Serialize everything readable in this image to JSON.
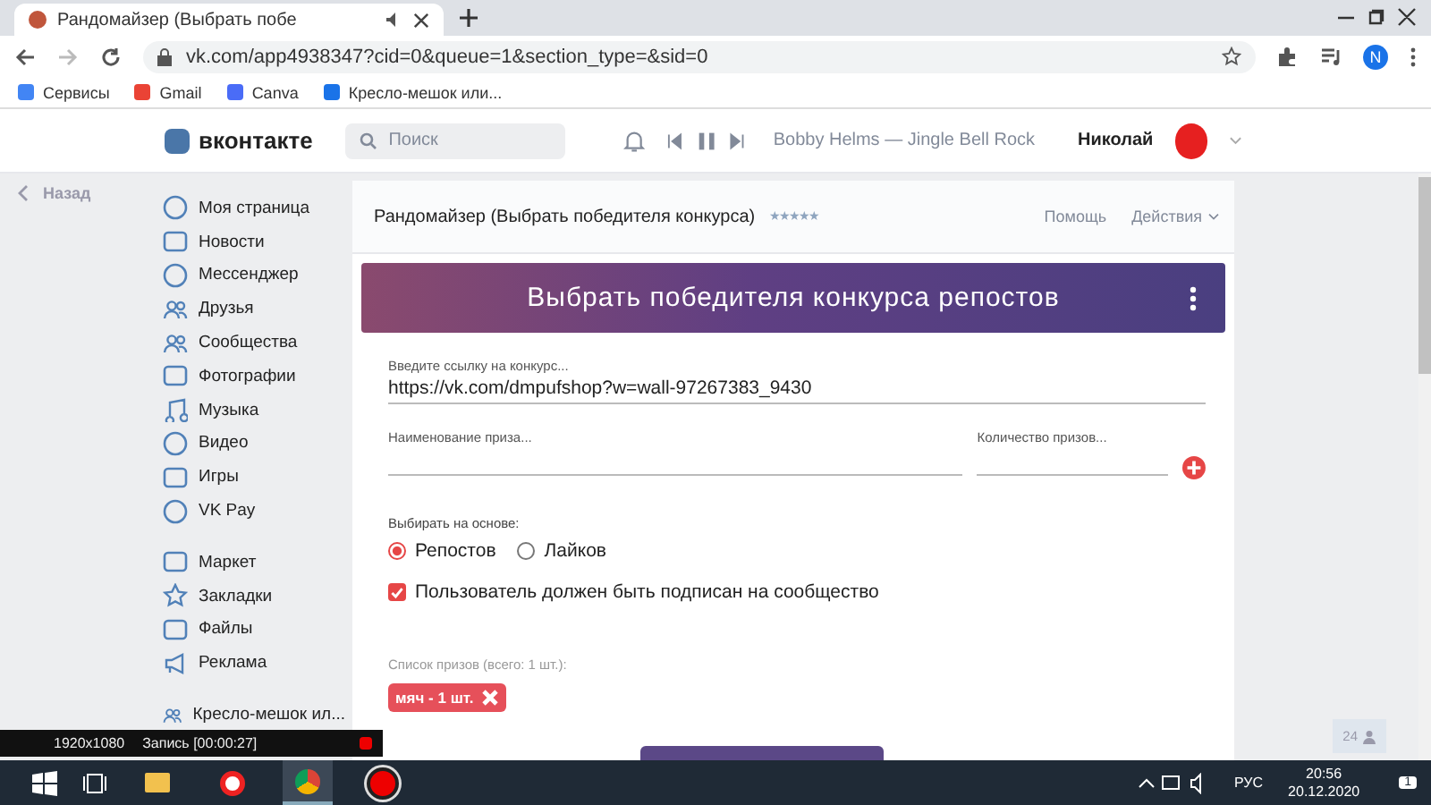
{
  "browser": {
    "tab_title": "Рандомайзер (Выбрать побе",
    "url": "vk.com/app4938347?cid=0&queue=1&section_type=&sid=0",
    "profile_initial": "N",
    "bookmarks": [
      {
        "label": "Сервисы",
        "kind": "apps"
      },
      {
        "label": "Gmail",
        "kind": "gmail"
      },
      {
        "label": "Canva",
        "kind": "canva"
      },
      {
        "label": "Кресло-мешок или...",
        "kind": "play"
      }
    ]
  },
  "header": {
    "logo": "вконтакте",
    "search_placeholder": "Поиск",
    "track": "Bobby Helms — Jingle Bell Rock",
    "user": "Николай"
  },
  "back": "Назад",
  "menu": [
    [
      {
        "label": "Моя страница",
        "kind": "user"
      },
      {
        "label": "Новости",
        "kind": "news"
      },
      {
        "label": "Мессенджер",
        "kind": "chat"
      },
      {
        "label": "Друзья",
        "kind": "friends"
      },
      {
        "label": "Сообщества",
        "kind": "groups"
      },
      {
        "label": "Фотографии",
        "kind": "photo"
      },
      {
        "label": "Музыка",
        "kind": "music"
      },
      {
        "label": "Видео",
        "kind": "video"
      },
      {
        "label": "Игры",
        "kind": "games"
      },
      {
        "label": "VK Pay",
        "kind": "pay"
      }
    ],
    [
      {
        "label": "Маркет",
        "kind": "market"
      },
      {
        "label": "Закладки",
        "kind": "star"
      },
      {
        "label": "Файлы",
        "kind": "file"
      },
      {
        "label": "Реклама",
        "kind": "ads"
      }
    ],
    [
      {
        "label": "Кресло-мешок ил...",
        "kind": "groups"
      }
    ]
  ],
  "app": {
    "title": "Рандомайзер (Выбрать победителя конкурса)",
    "stars": 5,
    "help": "Помощь",
    "actions": "Действия",
    "banner": "Выбрать победителя конкурса репостов",
    "link_label": "Введите ссылку на конкурс...",
    "link_value": "https://vk.com/dmpufshop?w=wall-97267383_9430",
    "prize_placeholder": "Наименование приза...",
    "count_placeholder": "Количество призов...",
    "basis_label": "Выбирать на основе:",
    "basis": [
      {
        "label": "Репостов",
        "selected": true
      },
      {
        "label": "Лайков",
        "selected": false
      }
    ],
    "subscribe": {
      "label": "Пользователь должен быть подписан на сообщество",
      "checked": true
    },
    "prizes_label": "Список призов (всего: 1 шт.):",
    "prizes": [
      "мяч - 1 шт."
    ]
  },
  "online_count": "24",
  "recorder": {
    "resolution": "1920x1080",
    "status": "Запись [00:00:27]"
  },
  "taskbar": {
    "lang": "РУС",
    "time": "20:56",
    "date": "20.12.2020",
    "notifications": "1"
  }
}
